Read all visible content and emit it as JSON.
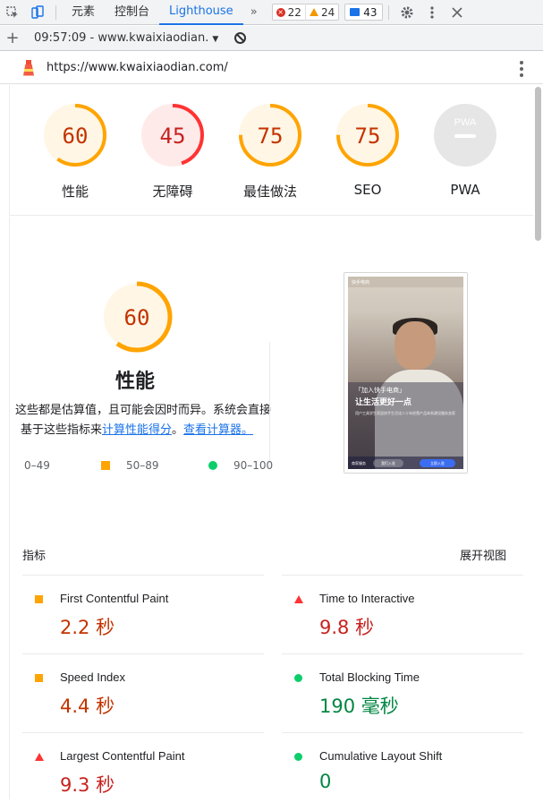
{
  "devtools": {
    "tabs": [
      "元素",
      "控制台",
      "Lighthouse"
    ],
    "active_tab": "Lighthouse",
    "more": "»",
    "errors": "22",
    "warnings": "24",
    "messages": "43"
  },
  "runbar": {
    "run_label": "09:57:09 - www.kwaixiaodian.",
    "caret": "▼",
    "add": "+"
  },
  "report": {
    "url": "https://www.kwaixiaodian.com/"
  },
  "gauges": [
    {
      "score": "60",
      "label": "性能",
      "value": 0.6,
      "color": "#ffa400",
      "bg": "#fff6e5",
      "text": "#c33300"
    },
    {
      "score": "45",
      "label": "无障碍",
      "value": 0.45,
      "color": "#ff3333",
      "bg": "#ffeaea",
      "text": "#c7221f"
    },
    {
      "score": "75",
      "label": "最佳做法",
      "value": 0.75,
      "color": "#ffa400",
      "bg": "#fff6e5",
      "text": "#c33300"
    },
    {
      "score": "75",
      "label": "SEO",
      "value": 0.75,
      "color": "#ffa400",
      "bg": "#fff6e5",
      "text": "#c33300"
    },
    {
      "score": "PWA",
      "label": "PWA",
      "value": 0,
      "color": "#e0e0e0",
      "bg": "#e6e6e6",
      "text": "#ffffff"
    }
  ],
  "performance": {
    "score": "60",
    "title": "性能",
    "desc_line1": "这些都是估算值，且可能会因时而异。系统会直接",
    "desc_line2_prefix": "基于这些指标来",
    "desc_link1": "计算性能得分",
    "desc_mid": "。",
    "desc_link2": "查看计算器。",
    "legend": [
      "0–49",
      "50–89",
      "90–100"
    ]
  },
  "screenshot": {
    "header": "快手电商",
    "tagline": "「加入快手电商」",
    "headline": "让生活更好一点",
    "body": "用户工具学生家居快手生活化二十年经营产品体系建设服务卖家",
    "btn1": "我们入驻",
    "btn2": "立即入驻",
    "btn_left": "商家服务"
  },
  "metrics": {
    "heading": "指标",
    "expand": "展开视图",
    "items": [
      {
        "name": "First Contentful Paint",
        "value": "2.2 秒",
        "status": "average"
      },
      {
        "name": "Time to Interactive",
        "value": "9.8 秒",
        "status": "fail"
      },
      {
        "name": "Speed Index",
        "value": "4.4 秒",
        "status": "average"
      },
      {
        "name": "Total Blocking Time",
        "value": "190 毫秒",
        "status": "pass"
      },
      {
        "name": "Largest Contentful Paint",
        "value": "9.3 秒",
        "status": "fail"
      },
      {
        "name": "Cumulative Layout Shift",
        "value": "0",
        "status": "pass"
      }
    ]
  }
}
